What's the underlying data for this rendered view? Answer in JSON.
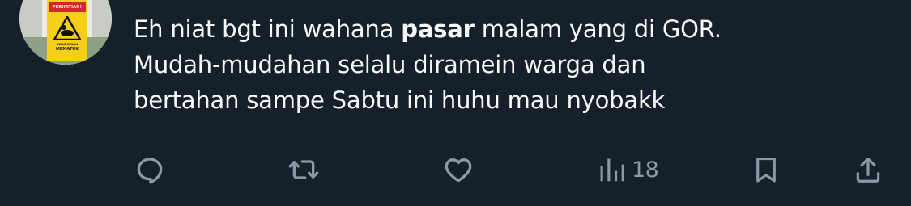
{
  "avatar": {
    "sign_header": "PERHATIAN!",
    "sign_small": "AWAS KENAN",
    "sign_big": "MEMATUK"
  },
  "tweet": {
    "text_before_bold": "Eh niat bgt ini wahana ",
    "text_bold": "pasar",
    "text_after_bold_line1": " malam yang di GOR.",
    "text_line2": "Mudah-mudahan selalu diramein warga dan",
    "text_line3": "bertahan sampe Sabtu ini huhu mau nyobakk"
  },
  "actions": {
    "reply_icon": "reply-icon",
    "retweet_icon": "retweet-icon",
    "like_icon": "heart-icon",
    "views_icon": "views-chart-icon",
    "views_count": "18",
    "bookmark_icon": "bookmark-icon",
    "share_icon": "share-icon"
  },
  "colors": {
    "background": "#15202b",
    "text": "#f7f9f9",
    "icon": "#8b98a5"
  }
}
